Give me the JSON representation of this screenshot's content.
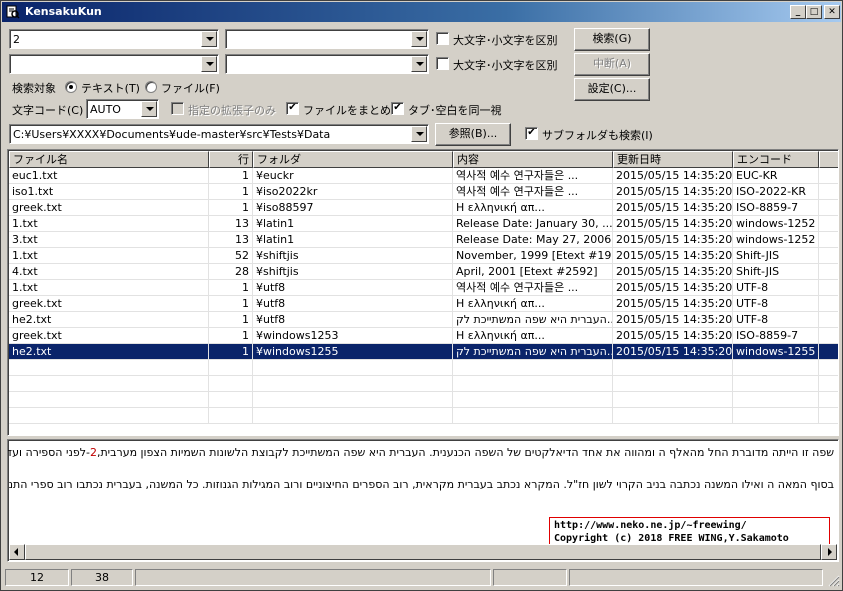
{
  "window": {
    "title": "KensakuKun",
    "minimize": "_",
    "maximize": "□",
    "close": "✕"
  },
  "search": {
    "pattern1": "2",
    "replace1": "",
    "pattern2": "",
    "replace2": "",
    "case_label": "大文字･小文字を区別",
    "search_button": "検索(G)",
    "stop_button": "中断(A)",
    "settings_button": "設定(C)...",
    "target_label": "検索対象",
    "target_text": "テキスト(T)",
    "target_file": "ファイル(F)",
    "encoding_label": "文字コード(C)",
    "encoding_value": "AUTO",
    "ext_only": "指定の拡張子のみ",
    "group_files": "ファイルをまとめる",
    "tab_space": "タブ･空白を同一視",
    "folder_path": "C:¥Users¥XXXX¥Documents¥ude-master¥src¥Tests¥Data",
    "browse_button": "参照(B)...",
    "subfolders": "サブフォルダも検索(I)"
  },
  "results": {
    "columns": [
      "ファイル名",
      "行",
      "フォルダ",
      "内容",
      "更新日時",
      "エンコード"
    ],
    "rows": [
      {
        "file": "euc1.txt",
        "line": "1",
        "folder": "¥euckr",
        "content": "역사적 예수 연구자들은 ...",
        "date": "2015/05/15 14:35:20",
        "enc": "EUC-KR"
      },
      {
        "file": "iso1.txt",
        "line": "1",
        "folder": "¥iso2022kr",
        "content": "역사적 예수 연구자들은 ...",
        "date": "2015/05/15 14:35:20",
        "enc": "ISO-2022-KR"
      },
      {
        "file": "greek.txt",
        "line": "1",
        "folder": "¥iso88597",
        "content": "Η ελληνική απ...",
        "date": "2015/05/15 14:35:20",
        "enc": "ISO-8859-7"
      },
      {
        "file": "1.txt",
        "line": "13",
        "folder": "¥latin1",
        "content": "Release Date: January 30, ...",
        "date": "2015/05/15 14:35:20",
        "enc": "windows-1252"
      },
      {
        "file": "3.txt",
        "line": "13",
        "folder": "¥latin1",
        "content": "Release Date: May 27, 2006...",
        "date": "2015/05/15 14:35:20",
        "enc": "windows-1252"
      },
      {
        "file": "1.txt",
        "line": "52",
        "folder": "¥shiftjis",
        "content": "November, 1999  [Etext #19...",
        "date": "2015/05/15 14:35:20",
        "enc": "Shift-JIS"
      },
      {
        "file": "4.txt",
        "line": "28",
        "folder": "¥shiftjis",
        "content": "April, 2001  [Etext #2592]",
        "date": "2015/05/15 14:35:20",
        "enc": "Shift-JIS"
      },
      {
        "file": "1.txt",
        "line": "1",
        "folder": "¥utf8",
        "content": "역사적 예수 연구자들은 ...",
        "date": "2015/05/15 14:35:20",
        "enc": "UTF-8"
      },
      {
        "file": "greek.txt",
        "line": "1",
        "folder": "¥utf8",
        "content": "Η ελληνική απ...",
        "date": "2015/05/15 14:35:20",
        "enc": "UTF-8"
      },
      {
        "file": "he2.txt",
        "line": "1",
        "folder": "¥utf8",
        "content": "העברית היא שפה המשתייכת לק...",
        "date": "2015/05/15 14:35:20",
        "enc": "UTF-8"
      },
      {
        "file": "greek.txt",
        "line": "1",
        "folder": "¥windows1253",
        "content": "Η ελληνική απ...",
        "date": "2015/05/15 14:35:20",
        "enc": "ISO-8859-7"
      },
      {
        "file": "he2.txt",
        "line": "1",
        "folder": "¥windows1255",
        "content": "העברית היא שפה המשתייכת לק...",
        "date": "2015/05/15 14:35:20",
        "enc": "windows-1255",
        "selected": true
      }
    ]
  },
  "preview": {
    "line1_before": "שפה זו הייתה מדוברת החל מהאלף ה ומהווה את אחד הדיאלקטים של השפה הכנענית. העברית היא שפה המשתייכת לקבוצת הלשונות השמיות הצפון מערבית,",
    "line1_red": "2",
    "line1_after": "-לפני הספירה ועד סוף העידן הקרוי הלבנט",
    "line2": "בסוף המאה ה ואילו המשנה נכתבה בניב הקרוי לשון חז\"ל. המקרא נכתב בעברית מקראית, רוב הספרים החיצוניים ורוב המגילות הגנוזות. כל המשנה, בעברית נכתבו רוב ספרי התנ\"ך,",
    "credit_url": "http://www.neko.ne.jp/~freewing/",
    "credit_copy": "Copyright (c) 2018 FREE WING,Y.Sakamoto"
  },
  "status": {
    "line": "12",
    "col": "38",
    "panel3": "",
    "panel4": "",
    "panel5": ""
  }
}
